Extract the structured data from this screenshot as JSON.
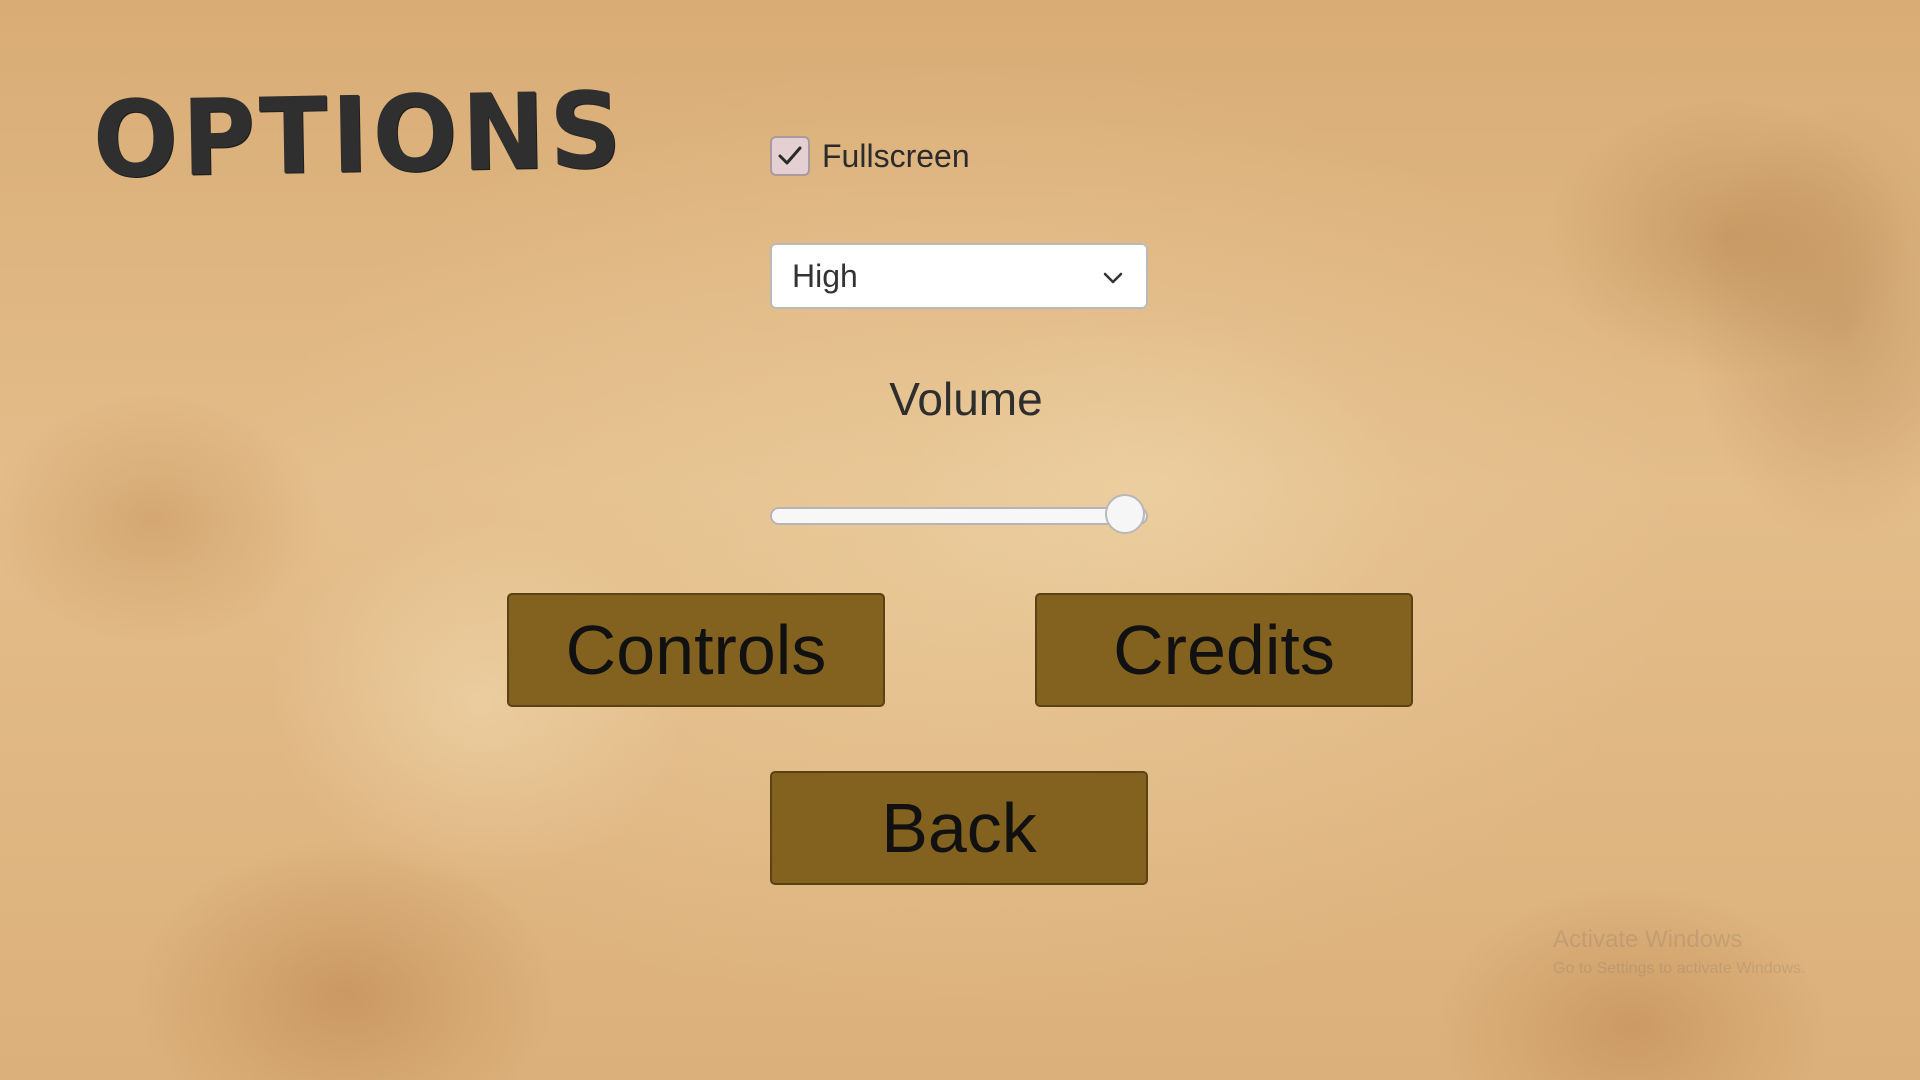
{
  "title": "OPTIONS",
  "fullscreen": {
    "label": "Fullscreen",
    "checked": true
  },
  "quality_dropdown": {
    "selected": "High",
    "icon": "chevron-down-icon"
  },
  "volume": {
    "label": "Volume",
    "value_fraction": 0.94
  },
  "buttons": {
    "controls": "Controls",
    "credits": "Credits",
    "back": "Back"
  },
  "watermark": {
    "title": "Activate Windows",
    "subtitle": "Go to Settings to activate Windows."
  },
  "colors": {
    "button_fill": "#83621f",
    "checkbox_fill": "#e4cfd3",
    "title_text": "#2f2f2f"
  }
}
